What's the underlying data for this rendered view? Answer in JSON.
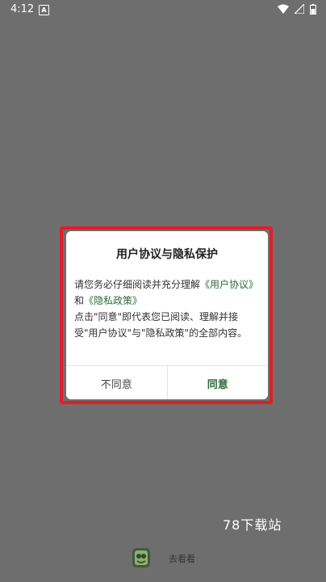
{
  "status_bar": {
    "time": "4:12",
    "notification_letter": "A"
  },
  "dialog": {
    "title": "用户协议与隐私保护",
    "body_line1_prefix": "请您务必仔细阅读并充分理解",
    "link_user_agreement": "《用户协议》",
    "body_and": "和",
    "link_privacy_policy": "《隐私政策》",
    "body_line3": "点击\"同意\"即代表您已阅读、理解并接受\"用户协议\"与\"隐私政策\"的全部内容。",
    "disagree_label": "不同意",
    "agree_label": "同意"
  },
  "watermark": "78下载站",
  "app": {
    "name": "去看看"
  },
  "colors": {
    "accent": "#2e6b3a",
    "highlight_border": "#e01e2a",
    "overlay": "#6e6e6e"
  }
}
